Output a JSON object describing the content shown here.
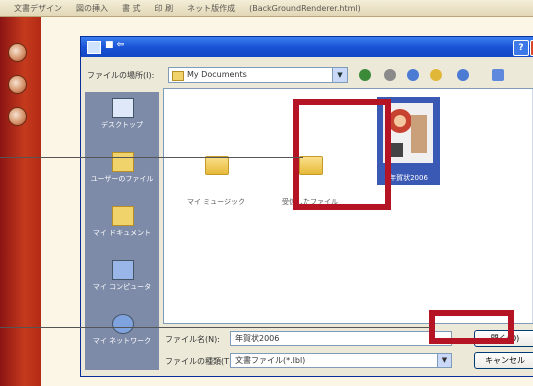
{
  "menubar": {
    "items": [
      "文書デザイン",
      "図の挿入",
      "書 式",
      "印 刷",
      "ネット版作成",
      "(BackGroundRenderer.html)"
    ]
  },
  "dialog": {
    "title_icon": "open-file-icon",
    "look_in_label": "ファイルの場所(I):",
    "look_in_value": "My Documents",
    "places": [
      {
        "label": "デスクトップ",
        "icon": "desktop-icon"
      },
      {
        "label": "ユーザーのファイル",
        "icon": "user-folder-icon"
      },
      {
        "label": "マイ ドキュメント",
        "icon": "my-documents-icon"
      },
      {
        "label": "マイ コンピュータ",
        "icon": "my-computer-icon"
      },
      {
        "label": "マイ ネットワーク",
        "icon": "network-icon"
      }
    ],
    "files": [
      {
        "label": "マイ ミュージック"
      },
      {
        "label": "受信したファイル"
      },
      {
        "label": "年賀状2006"
      }
    ],
    "filename_label": "ファイル名(N):",
    "filename_value": "年賀状2006",
    "filetype_label": "ファイルの種類(T):",
    "filetype_value": "文書ファイル(*.lbl)",
    "open_button": "開く(O)",
    "cancel_button": "キャンセル"
  },
  "colors": {
    "highlight": "#b41424",
    "titlebar": "#1a53d6"
  }
}
